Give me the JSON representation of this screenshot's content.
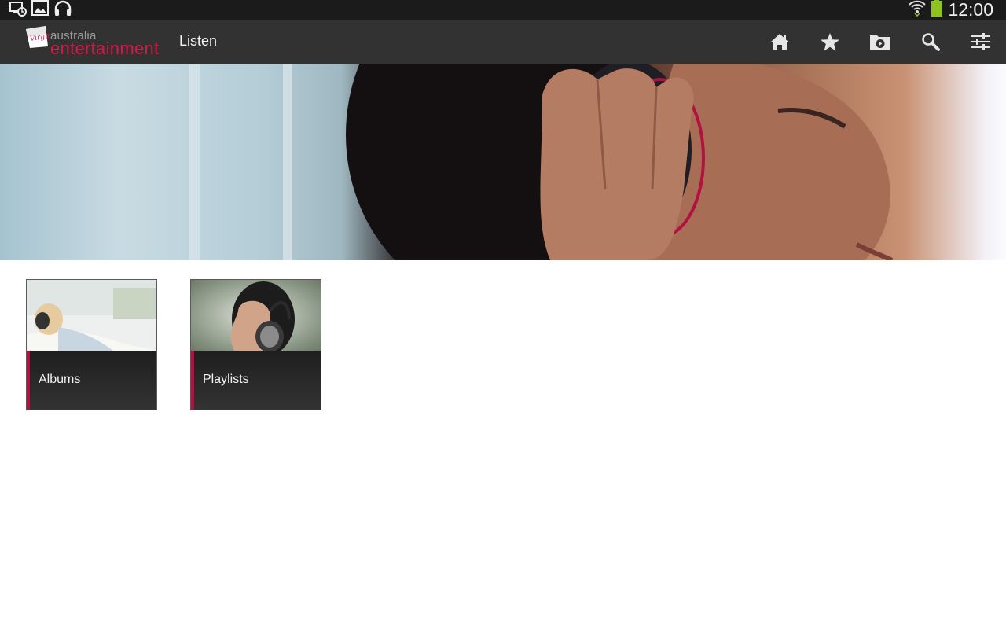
{
  "statusbar": {
    "left_icons": [
      "screen-timer-icon",
      "gallery-icon",
      "headphones-icon"
    ],
    "right_icons": [
      "wifi-icon",
      "battery-icon"
    ],
    "time": "12:00"
  },
  "actionbar": {
    "logo_small": "australia",
    "logo_main": "entertainment",
    "logo_badge": "Virgin",
    "title": "Listen",
    "icons": [
      "home-icon",
      "star-icon",
      "video-folder-icon",
      "search-icon",
      "settings-sliders-icon"
    ]
  },
  "hero": {
    "image": "woman-with-headphones-banner"
  },
  "tiles": [
    {
      "label": "Albums",
      "image": "woman-relaxing-with-headphones"
    },
    {
      "label": "Playlists",
      "image": "man-with-headphones"
    }
  ],
  "colors": {
    "statusbar_bg": "#1b1b1b",
    "actionbar_bg": "#323232",
    "accent": "#b0133f",
    "logo_red": "#d2194a",
    "battery": "#8dc21f"
  }
}
